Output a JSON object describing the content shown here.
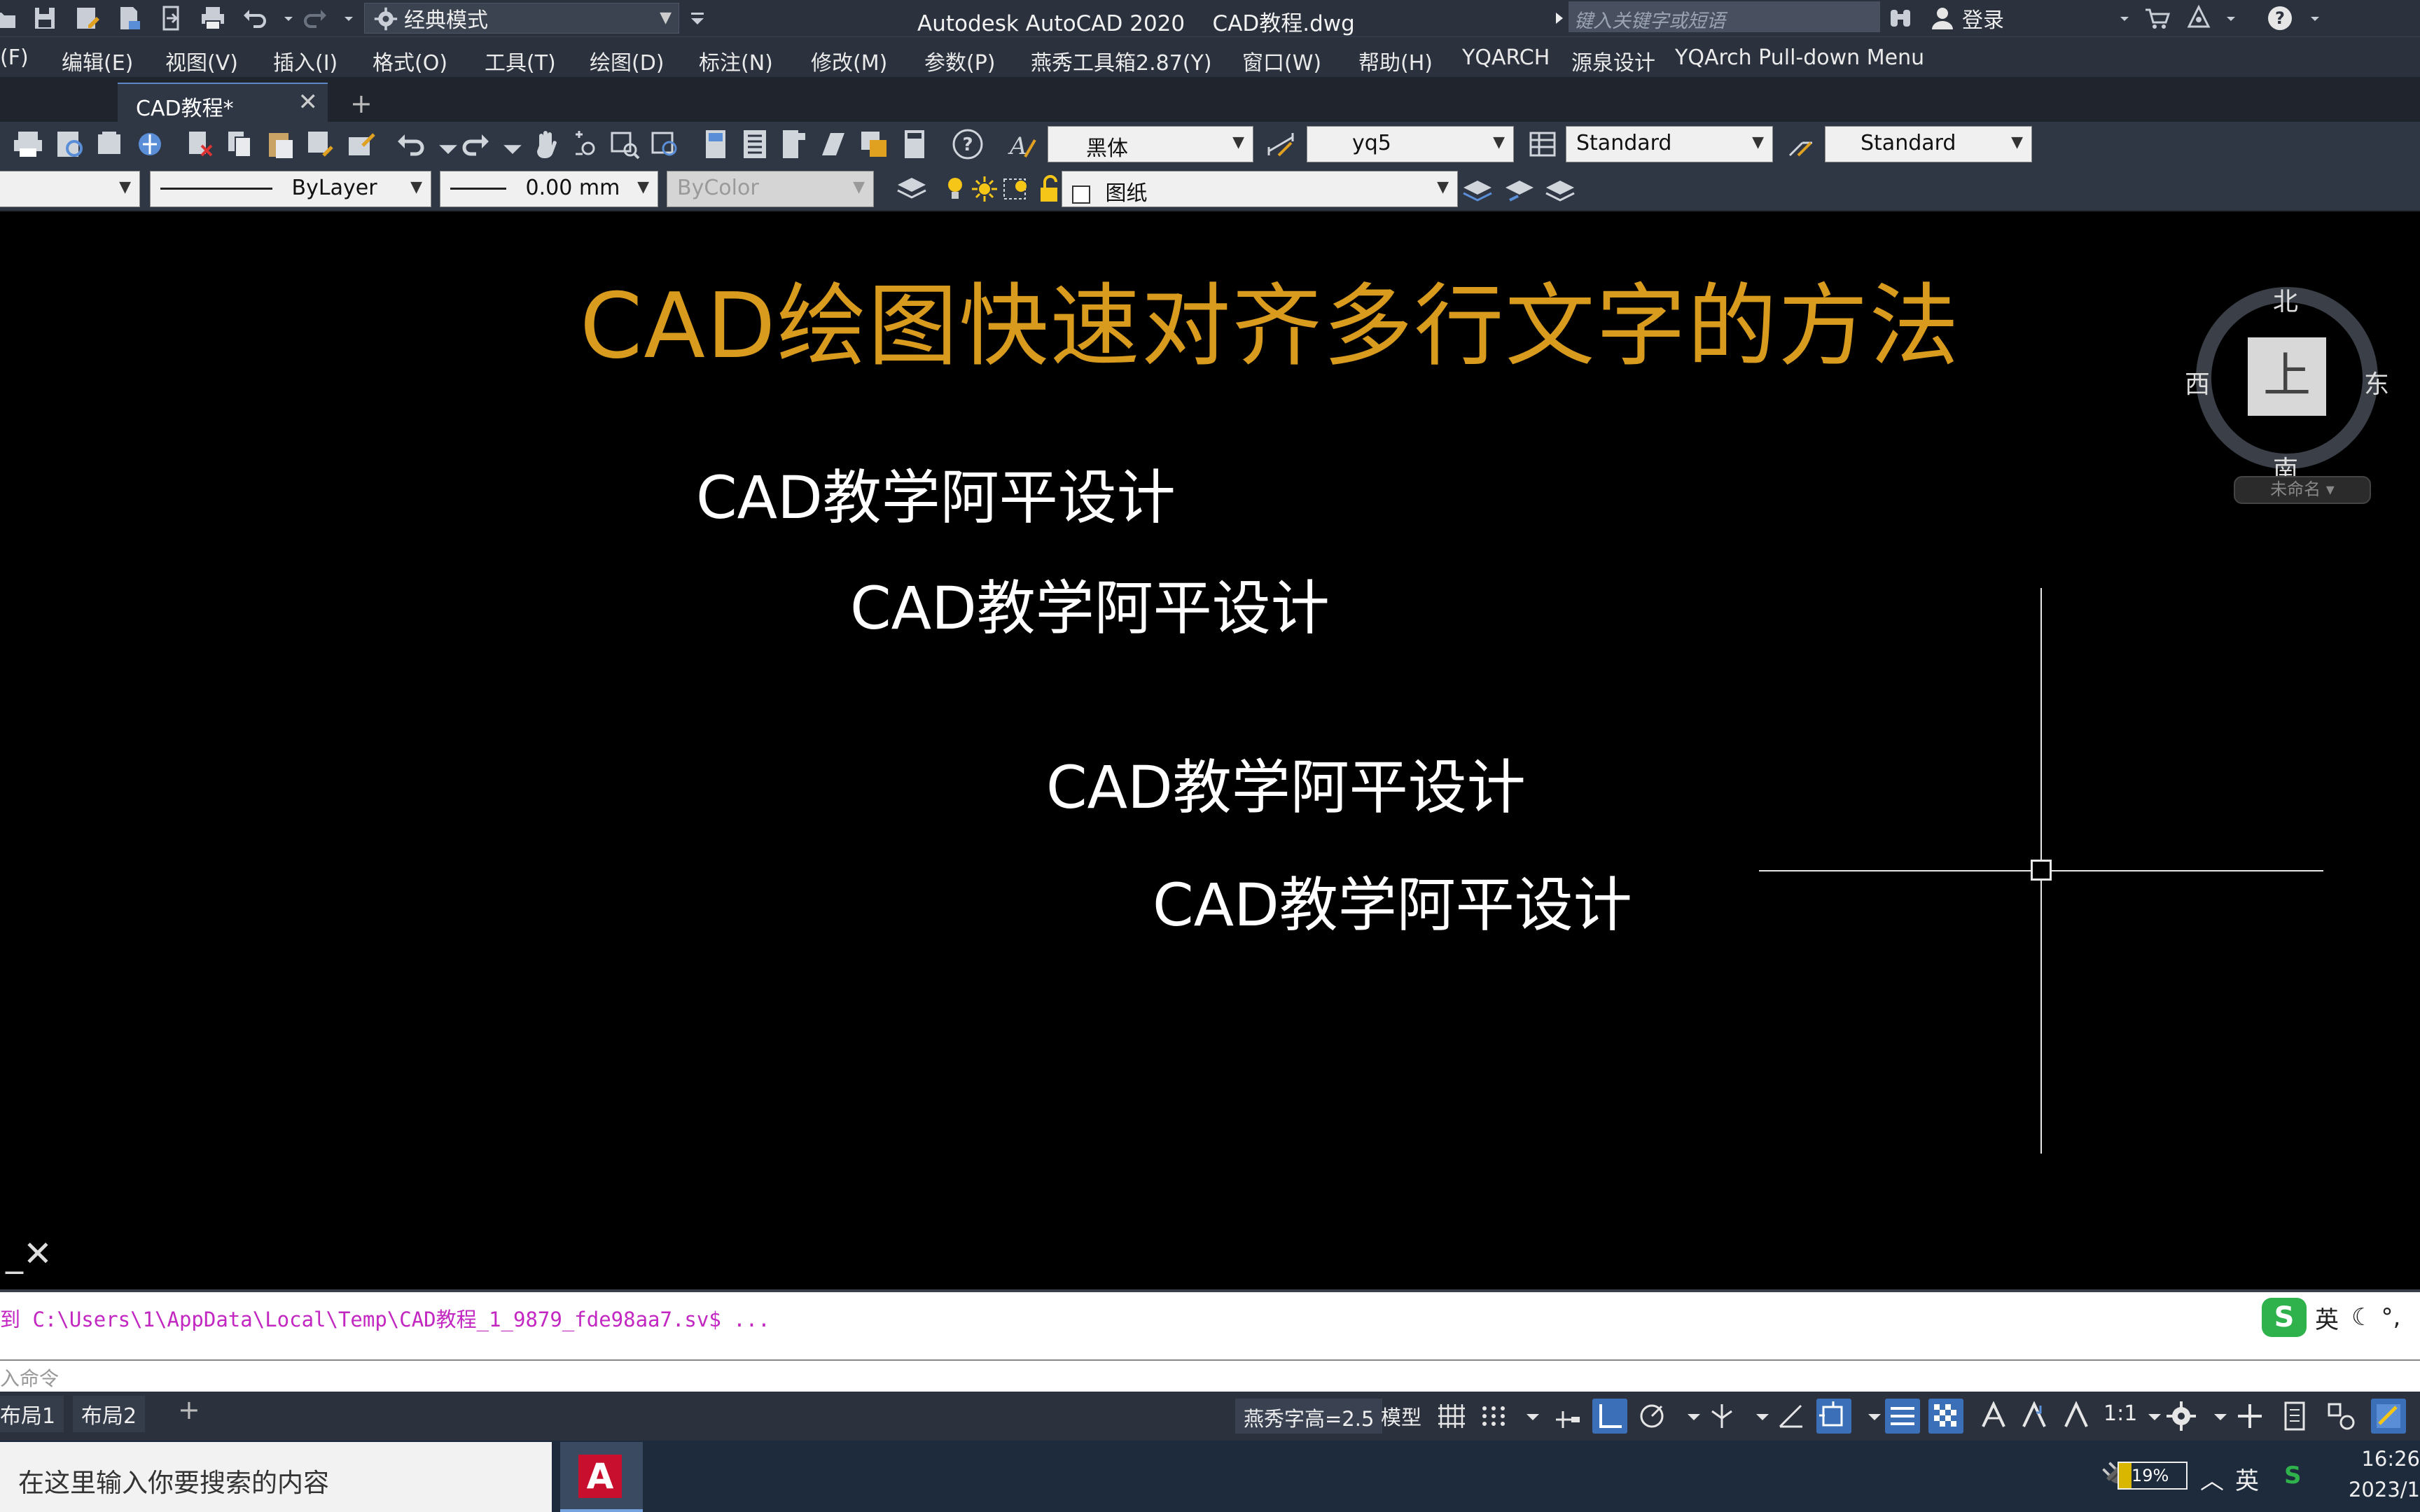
{
  "title_bar": {
    "workspace": "经典模式",
    "app_title": "Autodesk AutoCAD 2020    CAD教程.dwg",
    "search_placeholder": "键入关键字或短语",
    "login_label": "登录"
  },
  "menu": {
    "items": [
      "(F)",
      "编辑(E)",
      "视图(V)",
      "插入(I)",
      "格式(O)",
      "工具(T)",
      "绘图(D)",
      "标注(N)",
      "修改(M)",
      "参数(P)",
      "燕秀工具箱2.87(Y)",
      "窗口(W)",
      "帮助(H)",
      "YQARCH",
      "源泉设计",
      "YQArch Pull-down Menu"
    ]
  },
  "tabs": {
    "active": "CAD教程*",
    "new_tab": "+"
  },
  "toolbar1": {
    "text_font": "黑体",
    "dim_style": "yq5",
    "table_style": "Standard",
    "multileader_style": "Standard"
  },
  "toolbar2": {
    "linetype": "ByLayer",
    "lineweight": "0.00 mm",
    "plot_style": "ByColor",
    "layer": "图纸"
  },
  "drawing": {
    "title": "CAD绘图快速对齐多行文字的方法",
    "mtext": [
      "CAD教学阿平设计",
      "CAD教学阿平设计",
      "CAD教学阿平设计",
      "CAD教学阿平设计"
    ],
    "viewcube": {
      "north": "北",
      "south": "南",
      "west": "西",
      "east": "东",
      "face": "上"
    },
    "ucs_name": "未命名"
  },
  "command": {
    "history": "到 C:\\Users\\1\\AppData\\Local\\Temp\\CAD教程_1_9879_fde98aa7.sv$ ...",
    "input_placeholder": "入命令",
    "ime_label": "英"
  },
  "status_bar": {
    "layouts": [
      "布局1",
      "布局2"
    ],
    "add_layout": "+",
    "yanxiu_text": "燕秀字高=2.5",
    "model": "模型",
    "scale": "1:1"
  },
  "taskbar": {
    "search_placeholder": "在这里输入你要搜索的内容",
    "battery": "19%",
    "battery_level": 0.19,
    "ime": "英",
    "time": "16:26",
    "date": "2023/1"
  },
  "colors": {
    "title_orange": "#d89b1e",
    "command_magenta": "#c227c2",
    "canvas_bg": "#000000",
    "chrome_bg": "#2b313d"
  }
}
